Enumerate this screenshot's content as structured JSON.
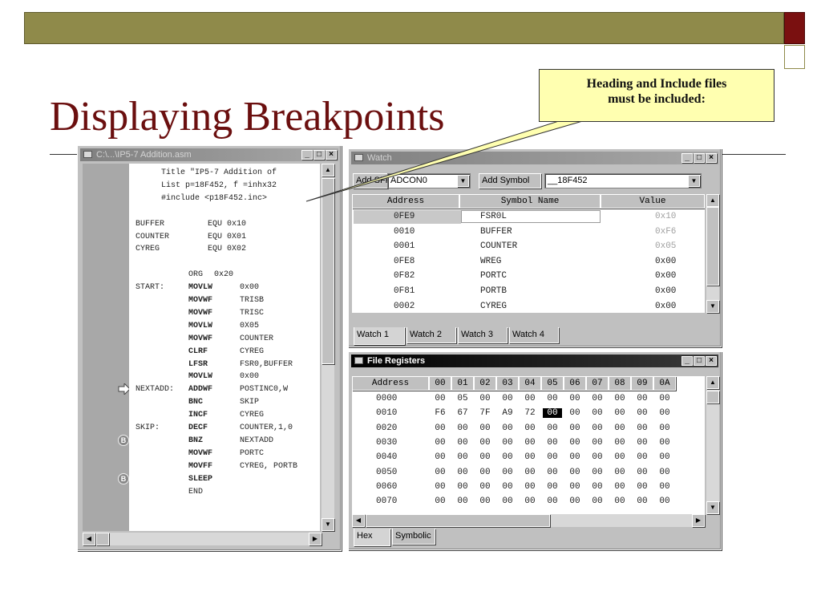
{
  "slide": {
    "title": "Displaying Breakpoints",
    "callout": [
      "Heading and Include files",
      "must be included:"
    ]
  },
  "code_window": {
    "title": "C:\\...\\IP5-7 Addition.asm",
    "lines": [
      {
        "label": "",
        "op": "",
        "text": "Title \"IP5-7 Addition of"
      },
      {
        "label": "",
        "op": "",
        "text": "List p=18F452, f =inhx32"
      },
      {
        "label": "",
        "op": "",
        "text": "#include <p18F452.inc>"
      },
      {
        "label": "",
        "op": "",
        "text": ""
      },
      {
        "label": "BUFFER",
        "op": "",
        "text": "EQU 0x10"
      },
      {
        "label": "COUNTER",
        "op": "",
        "text": "EQU 0X01"
      },
      {
        "label": "CYREG",
        "op": "",
        "text": "EQU 0X02"
      },
      {
        "label": "",
        "op": "",
        "text": ""
      },
      {
        "label": "",
        "op": "ORG",
        "text": "0x20"
      },
      {
        "label": "START:",
        "op": "MOVLW",
        "text": "0x00"
      },
      {
        "label": "",
        "op": "MOVWF",
        "text": "TRISB"
      },
      {
        "label": "",
        "op": "MOVWF",
        "text": "TRISC"
      },
      {
        "label": "",
        "op": "MOVLW",
        "text": "0X05"
      },
      {
        "label": "",
        "op": "MOVWF",
        "text": "COUNTER"
      },
      {
        "label": "",
        "op": "CLRF",
        "text": "CYREG"
      },
      {
        "label": "",
        "op": "LFSR",
        "text": "FSR0,BUFFER"
      },
      {
        "label": "",
        "op": "MOVLW",
        "text": "0x00"
      },
      {
        "label": "NEXTADD:",
        "op": "ADDWF",
        "text": "POSTINC0,W"
      },
      {
        "label": "",
        "op": "BNC",
        "text": "SKIP"
      },
      {
        "label": "",
        "op": "INCF",
        "text": "CYREG"
      },
      {
        "label": "SKIP:",
        "op": "DECF",
        "text": "COUNTER,1,0"
      },
      {
        "label": "",
        "op": "BNZ",
        "text": "NEXTADD"
      },
      {
        "label": "",
        "op": "MOVWF",
        "text": "PORTC"
      },
      {
        "label": "",
        "op": "MOVFF",
        "text": "CYREG, PORTB"
      },
      {
        "label": "",
        "op": "SLEEP",
        "text": ""
      },
      {
        "label": "",
        "op": "END",
        "text": ""
      }
    ],
    "markers": [
      {
        "type": "arrow",
        "line": 17
      },
      {
        "type": "breakpoint",
        "line": 21,
        "glyph": "B"
      },
      {
        "type": "breakpoint",
        "line": 24,
        "glyph": "B"
      }
    ]
  },
  "watch_window": {
    "title": "Watch",
    "add_sfr_label": "Add SFR",
    "sfr_value": "ADCON0",
    "add_symbol_label": "Add Symbol",
    "symbol_value": "__18F452",
    "columns": [
      "Address",
      "Symbol Name",
      "Value"
    ],
    "rows": [
      {
        "address": "0FE9",
        "symbol": "FSR0L",
        "value": "0x10",
        "dim": true
      },
      {
        "address": "0010",
        "symbol": "BUFFER",
        "value": "0xF6",
        "dim": true
      },
      {
        "address": "0001",
        "symbol": "COUNTER",
        "value": "0x05",
        "dim": true
      },
      {
        "address": "0FE8",
        "symbol": "WREG",
        "value": "0x00",
        "dim": false
      },
      {
        "address": "0F82",
        "symbol": "PORTC",
        "value": "0x00",
        "dim": false
      },
      {
        "address": "0F81",
        "symbol": "PORTB",
        "value": "0x00",
        "dim": false
      },
      {
        "address": "0002",
        "symbol": "CYREG",
        "value": "0x00",
        "dim": false
      }
    ],
    "tabs": [
      "Watch 1",
      "Watch 2",
      "Watch 3",
      "Watch 4"
    ]
  },
  "file_registers": {
    "title": "File Registers",
    "columns": [
      "Address",
      "00",
      "01",
      "02",
      "03",
      "04",
      "05",
      "06",
      "07",
      "08",
      "09",
      "0A"
    ],
    "rows": [
      {
        "address": "0000",
        "values": [
          "00",
          "05",
          "00",
          "00",
          "00",
          "00",
          "00",
          "00",
          "00",
          "00",
          "00"
        ],
        "dim": [
          1
        ]
      },
      {
        "address": "0010",
        "values": [
          "F6",
          "67",
          "7F",
          "A9",
          "72",
          "00",
          "00",
          "00",
          "00",
          "00",
          "00"
        ],
        "dim": [
          0,
          1,
          2,
          3,
          4
        ],
        "highlight": 5
      },
      {
        "address": "0020",
        "values": [
          "00",
          "00",
          "00",
          "00",
          "00",
          "00",
          "00",
          "00",
          "00",
          "00",
          "00"
        ]
      },
      {
        "address": "0030",
        "values": [
          "00",
          "00",
          "00",
          "00",
          "00",
          "00",
          "00",
          "00",
          "00",
          "00",
          "00"
        ]
      },
      {
        "address": "0040",
        "values": [
          "00",
          "00",
          "00",
          "00",
          "00",
          "00",
          "00",
          "00",
          "00",
          "00",
          "00"
        ]
      },
      {
        "address": "0050",
        "values": [
          "00",
          "00",
          "00",
          "00",
          "00",
          "00",
          "00",
          "00",
          "00",
          "00",
          "00"
        ]
      },
      {
        "address": "0060",
        "values": [
          "00",
          "00",
          "00",
          "00",
          "00",
          "00",
          "00",
          "00",
          "00",
          "00",
          "00"
        ]
      },
      {
        "address": "0070",
        "values": [
          "00",
          "00",
          "00",
          "00",
          "00",
          "00",
          "00",
          "00",
          "00",
          "00",
          "00"
        ]
      }
    ],
    "tabs": [
      "Hex",
      "Symbolic"
    ]
  }
}
